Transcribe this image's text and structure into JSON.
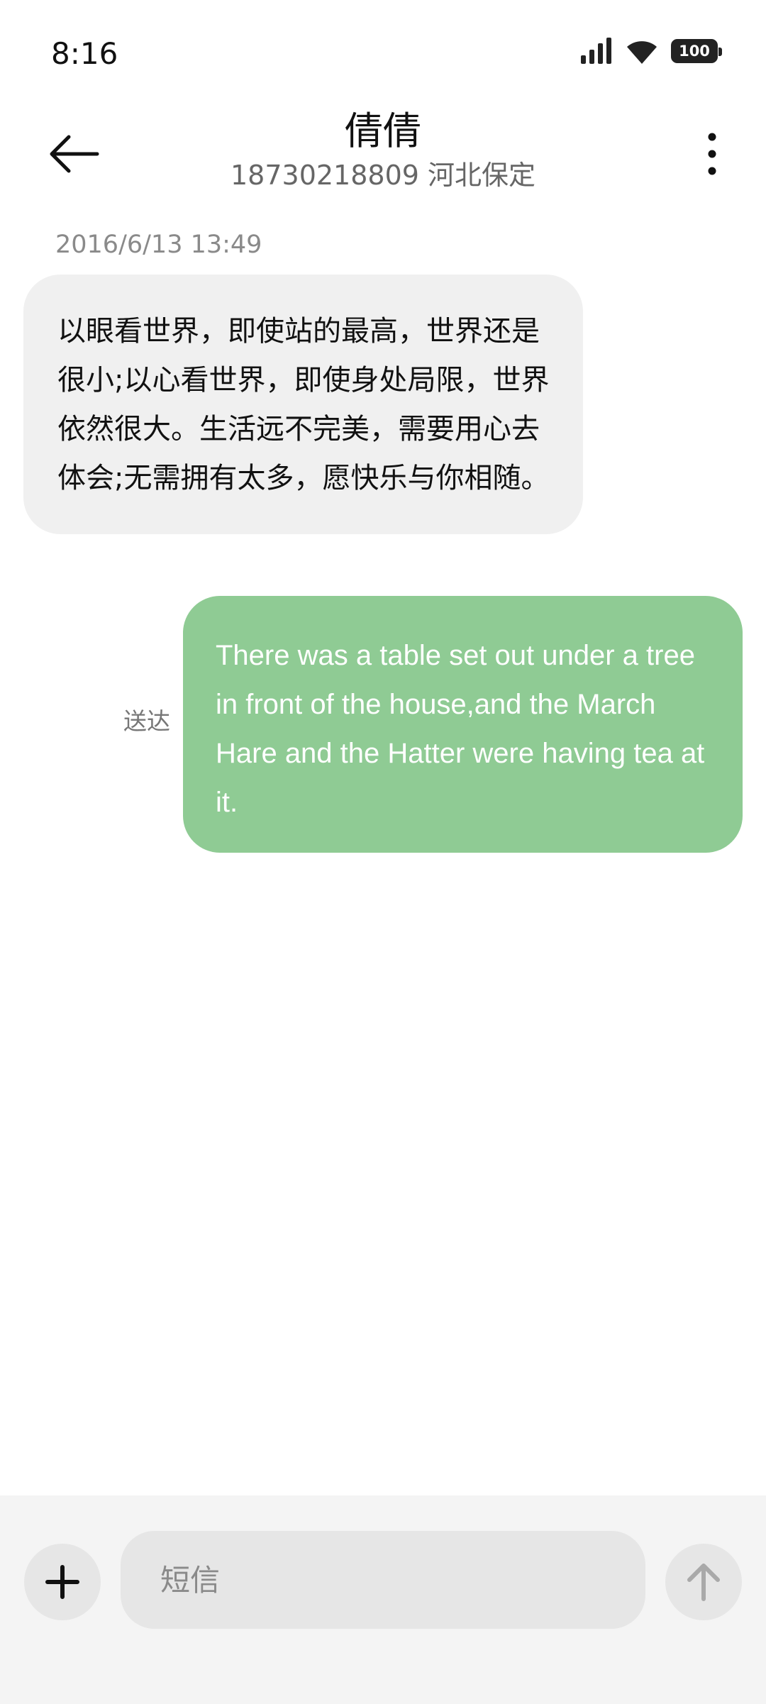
{
  "status_bar": {
    "time": "8:16",
    "battery_level": "100",
    "icons": [
      "signal-icon",
      "wifi-icon",
      "battery-icon"
    ]
  },
  "header": {
    "contact_name": "倩倩",
    "contact_subtitle": "18730218809 河北保定",
    "back_icon": "back-arrow-icon",
    "menu_icon": "more-vertical-icon"
  },
  "conversation": {
    "timestamp": "2016/6/13 13:49",
    "messages": [
      {
        "direction": "incoming",
        "text": "以眼看世界，即使站的最高，世界还是很小;以心看世界，即使身处局限，世界依然很大。生活远不完美，需要用心去体会;无需拥有太多，愿快乐与你相随。"
      },
      {
        "direction": "outgoing",
        "text": "There was a table set out under a tree in front of the house,and the March Hare and the Hatter were having tea at it.",
        "status": "送达"
      }
    ]
  },
  "composer": {
    "placeholder": "短信",
    "value": "",
    "add_icon": "plus-icon",
    "send_icon": "send-arrow-icon"
  },
  "colors": {
    "incoming_bubble": "#f0f0f0",
    "outgoing_bubble": "#8fcb94",
    "composer_background": "#f4f4f4"
  }
}
